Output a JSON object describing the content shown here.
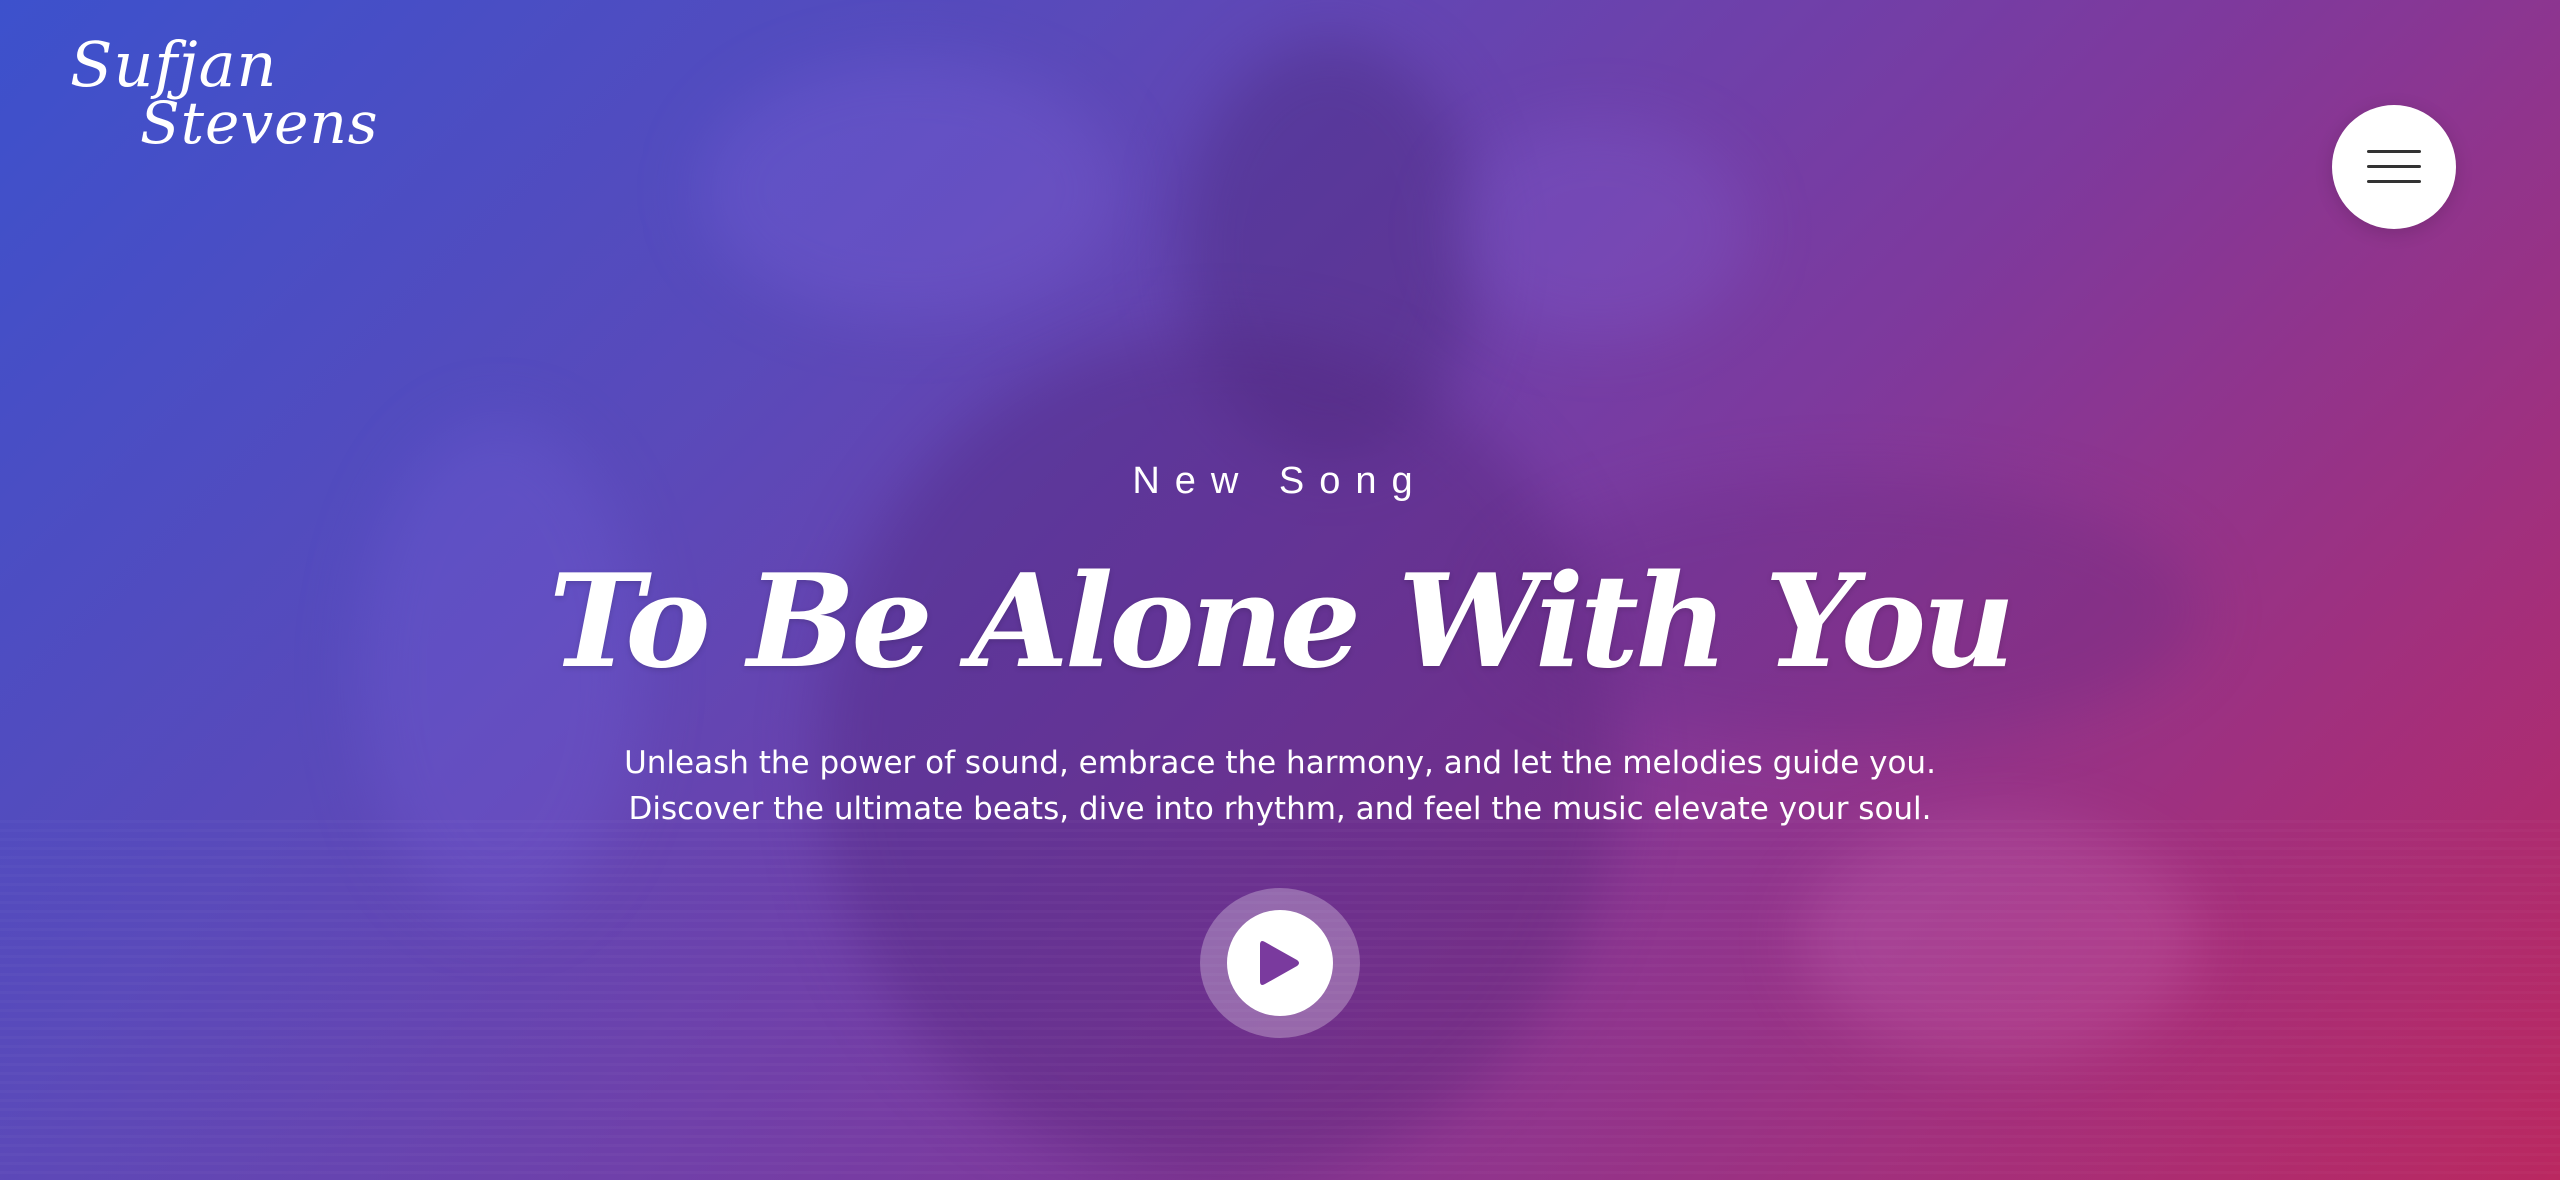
{
  "brand": {
    "line1": "Sufjan",
    "line2": "Stevens"
  },
  "menu": {
    "icon": "hamburger-icon"
  },
  "hero": {
    "eyebrow": "New Song",
    "title": "To Be Alone With You",
    "description_line1": "Unleash the power of sound, embrace the harmony, and let the melodies guide you.",
    "description_line2": "Discover the ultimate beats, dive into rhythm, and feel the music elevate your soul.",
    "play_icon": "play-icon"
  },
  "colors": {
    "gradient_start": "#3d52c9",
    "gradient_mid": "#7a3a9e",
    "gradient_end": "#b8285e",
    "play_accent": "#7a3a9e",
    "text": "#ffffff"
  }
}
